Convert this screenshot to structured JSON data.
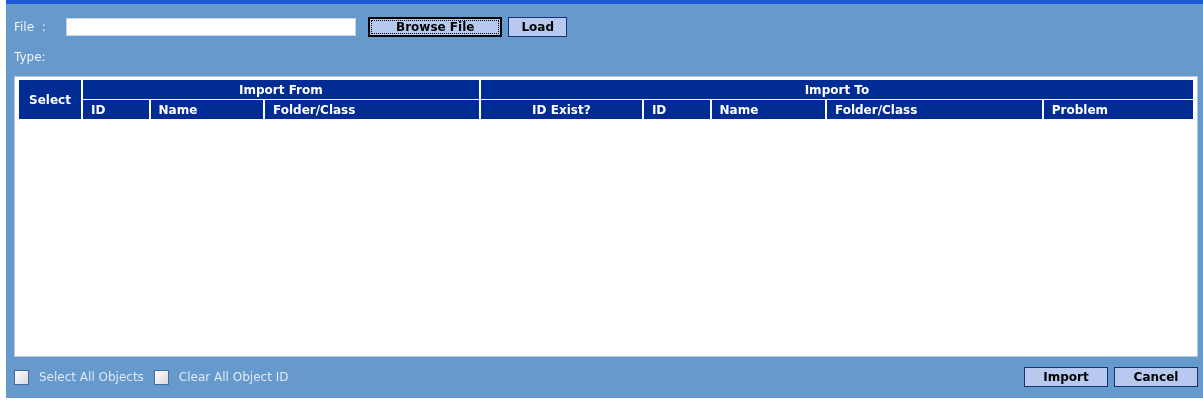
{
  "file_row": {
    "label": "File  :",
    "buttons": [
      {
        "label": "Browse File",
        "focused": true
      },
      {
        "label": "Load",
        "focused": false
      }
    ]
  },
  "type_label": "Type:",
  "table": {
    "select_header": "Select",
    "groups": [
      {
        "label": "Import From",
        "columns": [
          "ID",
          "Name",
          "Folder/Class"
        ]
      },
      {
        "label": "Import To",
        "columns": [
          "ID Exist?",
          "ID",
          "Name",
          "Folder/Class",
          "Problem"
        ]
      }
    ]
  },
  "options": [
    {
      "label": "Select All Objects",
      "checked": false
    },
    {
      "label": "Clear All Object ID",
      "checked": false
    }
  ],
  "actions": [
    "Import",
    "Cancel"
  ]
}
